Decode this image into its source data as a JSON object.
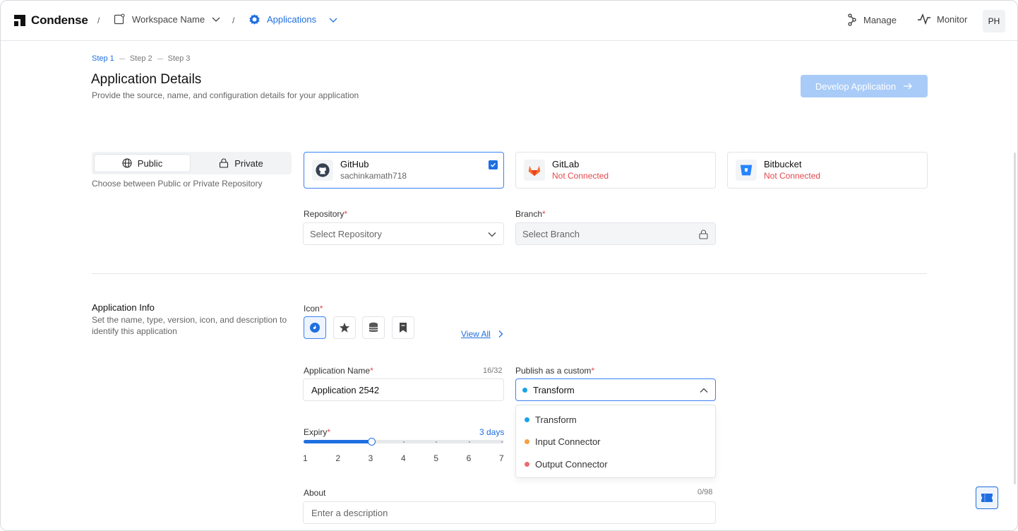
{
  "topbar": {
    "brand": "Condense",
    "separator": "/",
    "workspace": "Workspace Name",
    "section": "Applications",
    "manage": "Manage",
    "monitor": "Monitor",
    "avatar_initials": "PH"
  },
  "steps": [
    "Step 1",
    "Step 2",
    "Step 3"
  ],
  "header": {
    "title": "Application Details",
    "subtitle": "Provide the source, name, and configuration details for your application",
    "develop_button": "Develop Application"
  },
  "visibility": {
    "public": "Public",
    "private": "Private",
    "help": "Choose between Public or Private Repository",
    "selected": "Public"
  },
  "providers": [
    {
      "name": "GitHub",
      "status": "sachinkamath718",
      "selected": true,
      "icon": "github-icon"
    },
    {
      "name": "GitLab",
      "status": "Not Connected",
      "selected": false,
      "icon": "gitlab-icon"
    },
    {
      "name": "Bitbucket",
      "status": "Not Connected",
      "selected": false,
      "icon": "bitbucket-icon"
    }
  ],
  "repository": {
    "label": "Repository",
    "placeholder": "Select Repository"
  },
  "branch": {
    "label": "Branch",
    "placeholder": "Select Branch"
  },
  "app_info": {
    "title": "Application Info",
    "description": "Set the name, type, version, icon, and description to identify this application"
  },
  "icon_picker": {
    "label": "Icon",
    "view_all": "View All",
    "icons": [
      "compass-icon",
      "star-icon",
      "database-icon",
      "bookmark-icon"
    ]
  },
  "app_name": {
    "label": "Application Name",
    "value": "Application 2542",
    "counter": "16/32"
  },
  "publish": {
    "label": "Publish as a custom",
    "selected": "Transform",
    "options": [
      {
        "label": "Transform",
        "color": "#1aa3e8"
      },
      {
        "label": "Input Connector",
        "color": "#f5a142"
      },
      {
        "label": "Output Connector",
        "color": "#ee6b6e"
      }
    ]
  },
  "expiry": {
    "label": "Expiry",
    "value_text": "3 days",
    "value": 3,
    "ticks": [
      "1",
      "2",
      "3",
      "4",
      "5",
      "6",
      "7"
    ]
  },
  "about": {
    "label": "About",
    "placeholder": "Enter a description",
    "counter": "0/98"
  },
  "colors": {
    "accent": "#1f6fe0",
    "error": "#e5484d",
    "button_disabled": "#a9cbf7"
  }
}
